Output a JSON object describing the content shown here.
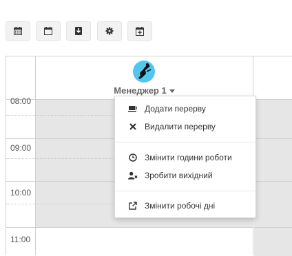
{
  "toolbar": {
    "buttons": [
      {
        "name": "calendar-grid-icon"
      },
      {
        "name": "calendar-icon"
      },
      {
        "name": "download-icon"
      },
      {
        "name": "gear-icon"
      },
      {
        "name": "calendar-plus-icon"
      }
    ]
  },
  "schedule": {
    "times": [
      "08:00",
      "09:00",
      "10:00",
      "11:00"
    ],
    "staff": {
      "name": "Менеджер 1",
      "avatar_color": "#52c6ec"
    }
  },
  "context_menu": {
    "items": [
      {
        "icon": "coffee-icon",
        "label": "Додати перерву"
      },
      {
        "icon": "close-icon",
        "label": "Видалити перерву"
      },
      {
        "icon": "clock-icon",
        "label": "Змінити години роботи"
      },
      {
        "icon": "user-times-icon",
        "label": "Зробити вихідний"
      },
      {
        "icon": "external-link-icon",
        "label": "Змінити робочі дні"
      }
    ]
  },
  "colors": {
    "off_hours_shade": "#e6e6e6",
    "grid_line": "#d0d0d0",
    "avatar_bg": "#52c6ec"
  }
}
